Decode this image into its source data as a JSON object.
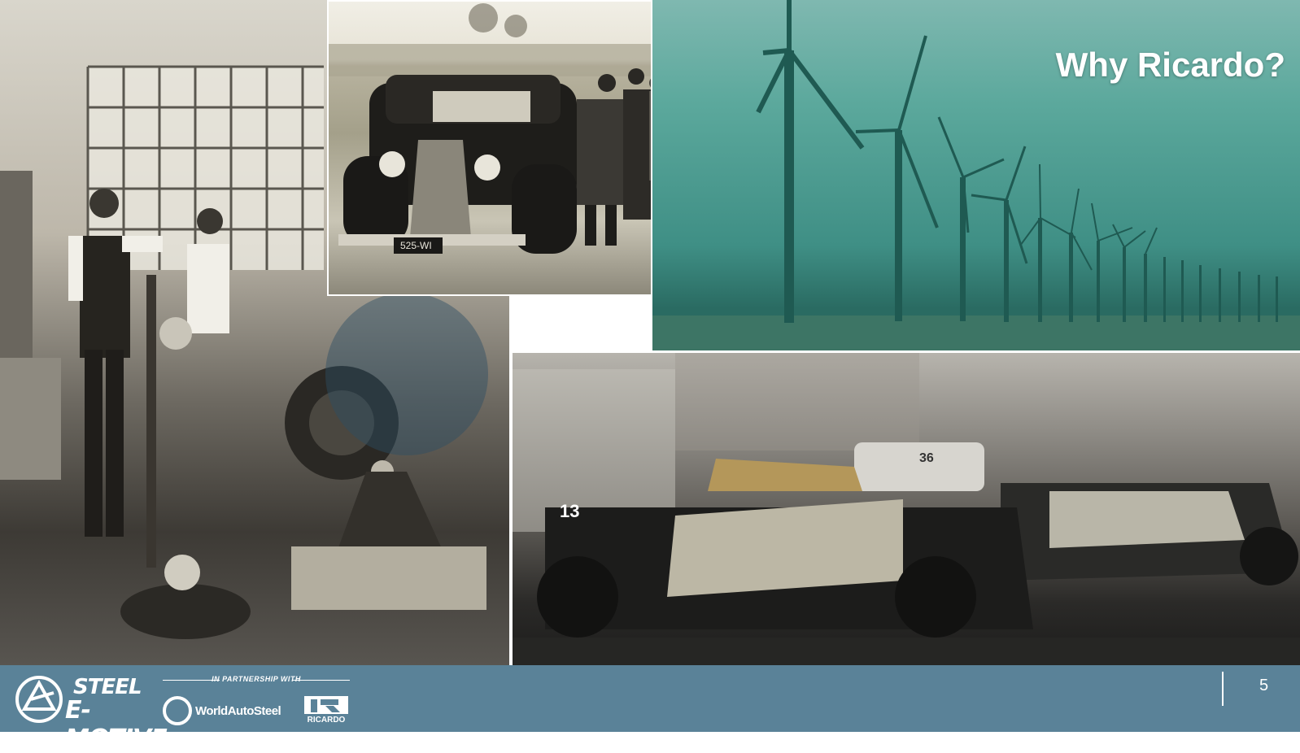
{
  "slide": {
    "title": "Why Ricardo?",
    "page_number": "5"
  },
  "footer": {
    "steel_logo_line1": "STEEL",
    "steel_logo_line2": "E-MOTIVE",
    "partnership_label": "IN PARTNERSHIP WITH",
    "partner1": "WorldAutoSteel",
    "partner2": "RICARDO",
    "background_color": "#5a8298"
  },
  "photos": {
    "workshop": "sepia-workshop-engine-photo",
    "car": "vintage-car-photo",
    "wind": "offshore-wind-farm-photo",
    "race": "electric-race-cars-photo"
  },
  "race_car_numbers": [
    "13",
    "36"
  ]
}
